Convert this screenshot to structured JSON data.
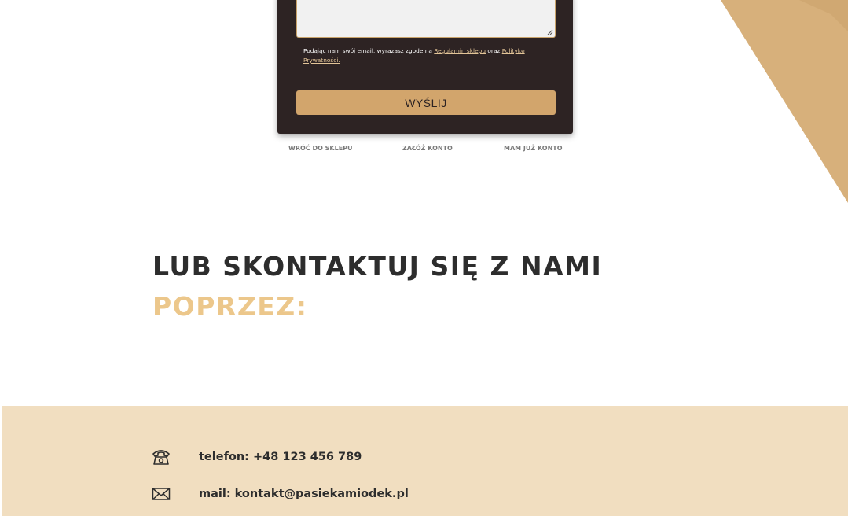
{
  "form": {
    "consent_prefix": "Podając nam swój email, wyrazasz zgode na",
    "terms_link": "Regulamin sklepu",
    "consent_join": "oraz",
    "privacy_link": "Politykę Prywatności.",
    "submit_label": "WYŚLIJ"
  },
  "form_links": {
    "back_to_shop": "WRÓĆ DO SKLEPU",
    "create_account": "ZAŁÓŻ KONTO",
    "have_account": "MAM JUŻ KONTO"
  },
  "heading": {
    "line1": "Lub skontaktuj się z nami",
    "line2": "poprzez:"
  },
  "contact": {
    "phone": "telefon: +48 123 456 789",
    "email": "mail: kontakt@pasiekamiodek.pl"
  },
  "colors": {
    "card_bg": "#2d2323",
    "accent": "#d2a56c",
    "heading_accent": "#ecc78b",
    "band_bg": "#f1dec0",
    "text_dark": "#2d2d2d"
  },
  "icons": {
    "phone": "telephone-icon",
    "mail": "envelope-icon"
  }
}
